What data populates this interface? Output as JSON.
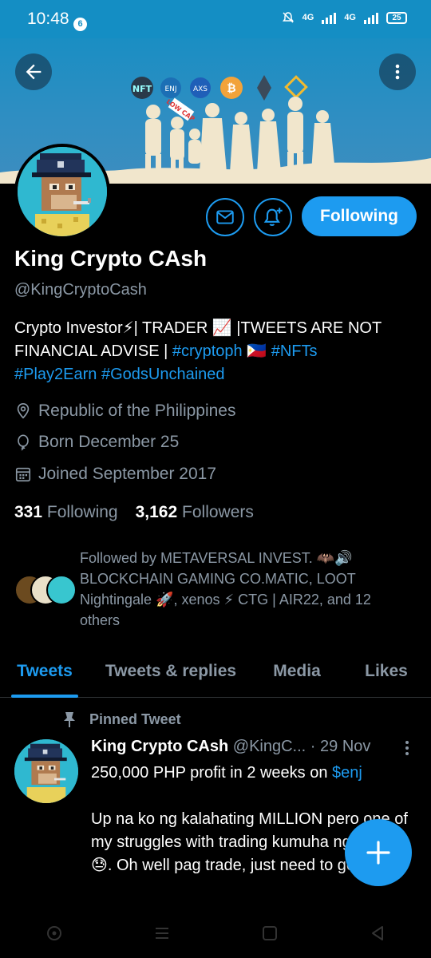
{
  "status_bar": {
    "time": "10:48",
    "notification_count": "6",
    "network_1": "4G",
    "network_2": "4G",
    "battery": "25"
  },
  "banner": {
    "coins": [
      "NFT",
      "ENJ",
      "AXS",
      "BTC",
      "ETH",
      "BNB"
    ],
    "sign_text": "LOW CAP"
  },
  "profile": {
    "name": "King Crypto CAsh",
    "handle": "@KingCryptoCash",
    "follow_button": "Following",
    "bio_part1": "Crypto Investor⚡| TRADER 📈 |TWEETS ARE NOT FINANCIAL ADVISE | ",
    "bio_tag1": "#cryptoph",
    "bio_flag": " 🇵🇭 ",
    "bio_tag2": "#NFTs",
    "bio_tag3": "#Play2Earn",
    "bio_tag4": "#GodsUnchained",
    "location": "Republic of the Philippines",
    "birthday": "Born December 25",
    "joined": "Joined September 2017",
    "following_count": "331",
    "following_label": "Following",
    "followers_count": "3,162",
    "followers_label": "Followers",
    "followed_by": "Followed by METAVERSAL INVEST. 🦇🔊 BLOCKCHAIN GAMING CO.MATIC, LOOT Nightingale 🚀, xenos ⚡ CTG | AIR22, and 12 others"
  },
  "tabs": [
    "Tweets",
    "Tweets & replies",
    "Media",
    "Likes"
  ],
  "pinned_tweet": {
    "label": "Pinned Tweet",
    "author": "King Crypto CAsh",
    "handle": "@KingC...",
    "date": "· 29 Nov",
    "text_line1": "250,000 PHP profit in 2 weeks on ",
    "cashtag": "$enj",
    "text_rest": "Up na ko ng kalahating MILLION pero one of my struggles with trading kumuha ng profit😓. Oh well pag trade, just need to get better"
  },
  "colors": {
    "accent": "#1d9bf0",
    "background": "#000000",
    "muted": "#8b98a5",
    "status_bar": "#148ec4"
  },
  "icons": [
    "back-arrow-icon",
    "more-vertical-icon",
    "mail-icon",
    "bell-plus-icon",
    "location-pin-icon",
    "balloon-icon",
    "calendar-icon",
    "pin-icon",
    "compose-plus-icon"
  ]
}
